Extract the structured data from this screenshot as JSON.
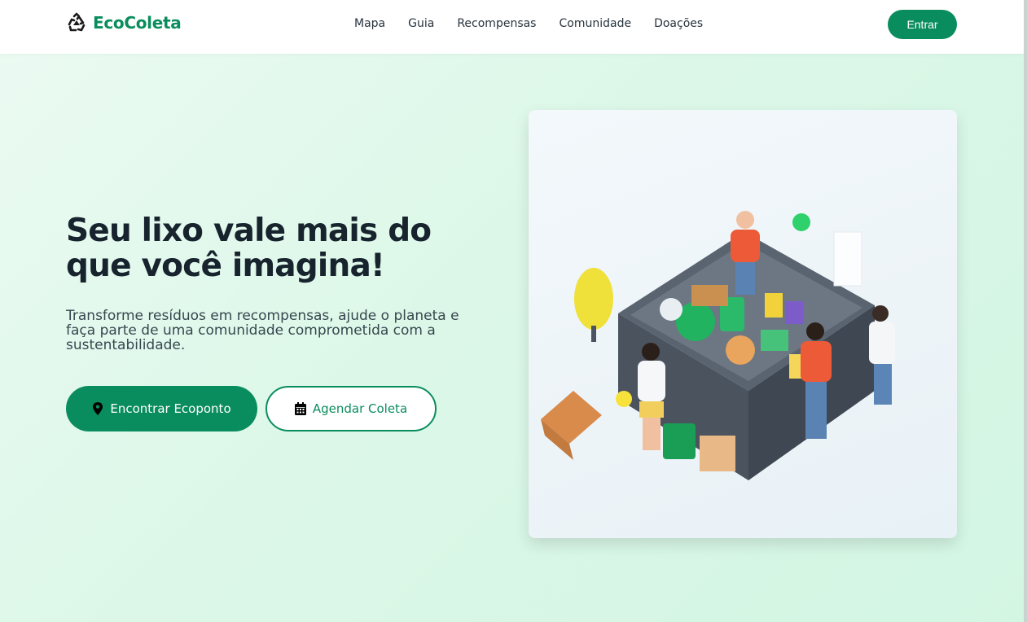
{
  "brand": {
    "name": "EcoColeta",
    "logo_icon": "recycle-icon",
    "accent": "#0a8d5e"
  },
  "nav": {
    "items": [
      {
        "label": "Mapa"
      },
      {
        "label": "Guia"
      },
      {
        "label": "Recompensas"
      },
      {
        "label": "Comunidade"
      },
      {
        "label": "Doações"
      }
    ],
    "login_label": "Entrar"
  },
  "hero": {
    "title": "Seu lixo vale mais do que você imagina!",
    "subtitle": "Transforme resíduos em recompensas, ajude o planeta e faça parte de uma comunidade comprometida com a sustentabilidade.",
    "primary_button": {
      "label": "Encontrar Ecoponto",
      "icon": "map-pin-icon"
    },
    "secondary_button": {
      "label": "Agendar Coleta",
      "icon": "calendar-icon"
    },
    "illustration": "recycling-container-illustration"
  }
}
